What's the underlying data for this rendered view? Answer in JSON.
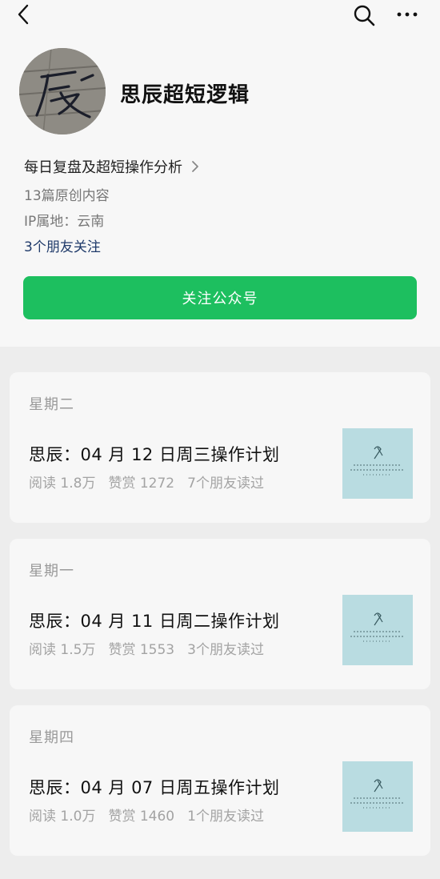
{
  "account": {
    "name": "思辰超短逻辑",
    "avatar_text": "辰",
    "intro": "每日复盘及超短操作分析",
    "original_count": "13篇原创内容",
    "ip_location": "IP属地：云南",
    "friends_follow": "3个朋友关注"
  },
  "follow_button": "关注公众号",
  "articles": [
    {
      "day": "星期二",
      "title": "思辰：04 月 12 日周三操作计划",
      "reads": "阅读 1.8万",
      "likes": "赞赏 1272",
      "friends_read": "7个朋友读过"
    },
    {
      "day": "星期一",
      "title": "思辰：04 月 11 日周二操作计划",
      "reads": "阅读 1.5万",
      "likes": "赞赏 1553",
      "friends_read": "3个朋友读过"
    },
    {
      "day": "星期四",
      "title": "思辰：04 月 07 日周五操作计划",
      "reads": "阅读 1.0万",
      "likes": "赞赏 1460",
      "friends_read": "1个朋友读过"
    }
  ],
  "colors": {
    "accent_green": "#1dbf5f",
    "friends_blue": "#1f3a6a",
    "thumb_bg": "#b9dce1"
  }
}
